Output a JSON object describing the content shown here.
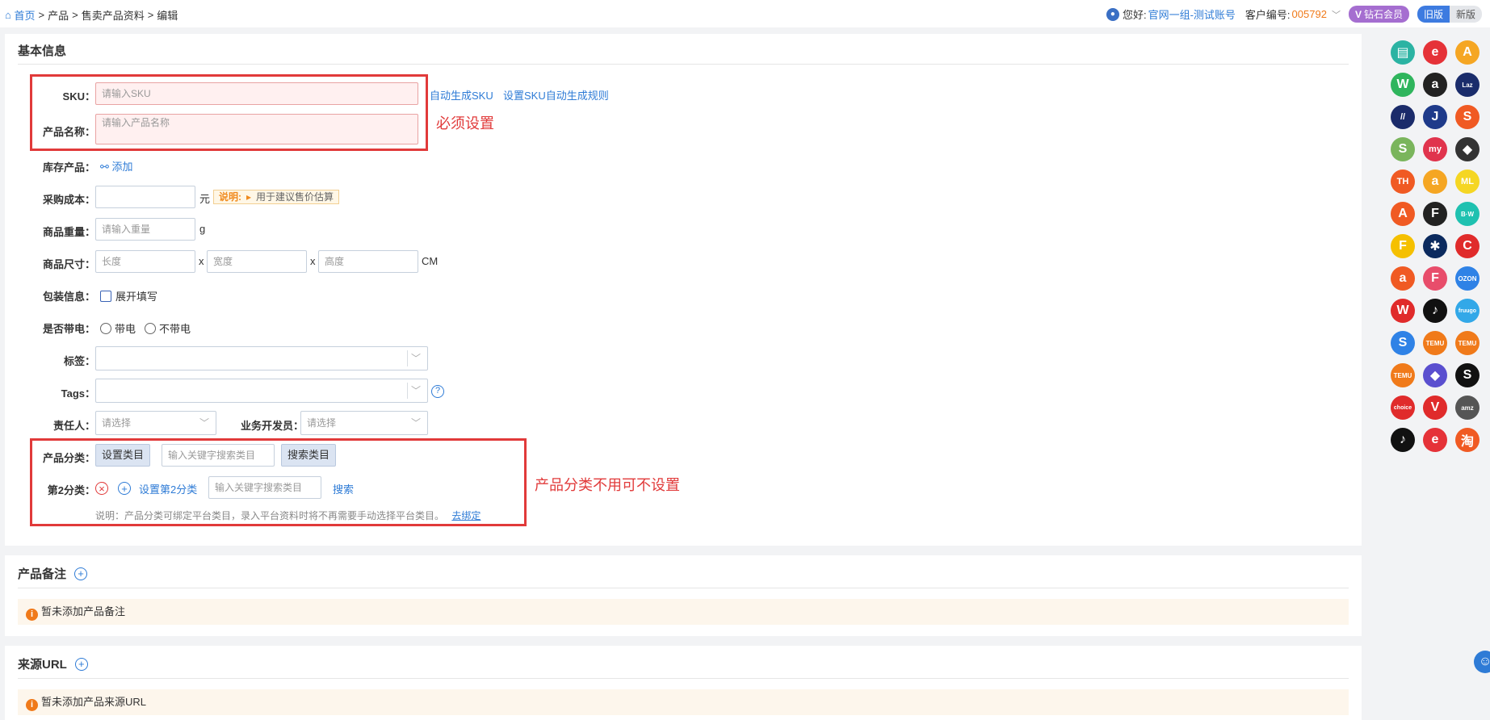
{
  "breadcrumb": {
    "home": "首页",
    "sep": ">",
    "items": [
      "产品",
      "售卖产品资料",
      "编辑"
    ]
  },
  "header": {
    "greeting": "您好:",
    "account": "官网一组-测试账号",
    "customer_label": "客户编号:",
    "customer_no": "005792",
    "vip": "钻石会员",
    "old_version": "旧版",
    "new_version": "新版"
  },
  "basic": {
    "title": "基本信息",
    "sku_label": "SKU：",
    "sku_placeholder": "请输入SKU",
    "auto_sku": "自动生成SKU",
    "sku_rule": "设置SKU自动生成规则",
    "name_label": "产品名称：",
    "name_placeholder": "请输入产品名称",
    "required_note": "必须设置",
    "stock_label": "库存产品：",
    "stock_add": "添加",
    "cost_label": "采购成本：",
    "cost_unit": "元",
    "tip_key": "说明:",
    "tip_text": "用于建议售价估算",
    "weight_label": "商品重量：",
    "weight_placeholder": "请输入重量",
    "weight_unit": "g",
    "size_label": "商品尺寸：",
    "len_placeholder": "长度",
    "wid_placeholder": "宽度",
    "hei_placeholder": "高度",
    "size_x": "x",
    "size_unit": "CM",
    "pack_label": "包装信息：",
    "pack_text": "展开填写",
    "elec_label": "是否带电：",
    "elec_yes": "带电",
    "elec_no": "不带电",
    "tag_label": "标签：",
    "tags_label": "Tags：",
    "owner_label": "责任人：",
    "owner_placeholder": "请选择",
    "dev_label": "业务开发员：",
    "dev_placeholder": "请选择",
    "cat_label": "产品分类：",
    "set_cat": "设置类目",
    "cat_search_placeholder": "输入关键字搜索类目",
    "search_cat": "搜索类目",
    "cat2_label": "第2分类：",
    "set_cat2": "设置第2分类",
    "cat2_search_placeholder": "输入关键字搜索类目",
    "search": "搜索",
    "cat_note": "说明：产品分类可绑定平台类目，录入平台资料时将不再需要手动选择平台类目。",
    "bind_link": "去绑定",
    "cat_red_note": "产品分类不用可不设置"
  },
  "remark": {
    "title": "产品备注",
    "empty": "暂未添加产品备注"
  },
  "source": {
    "title": "来源URL",
    "empty": "暂未添加产品来源URL"
  },
  "platforms": [
    {
      "name": "doc-platform-icon",
      "t": "▤",
      "c": "#2bb3a3"
    },
    {
      "name": "ebay-icon",
      "t": "e",
      "c": "#e53238"
    },
    {
      "name": "aliexpress-a-icon",
      "t": "A",
      "c": "#f5a623"
    },
    {
      "name": "wish-icon",
      "t": "W",
      "c": "#2fb55d"
    },
    {
      "name": "amazon-icon",
      "t": "a",
      "c": "#222"
    },
    {
      "name": "lazada-icon",
      "t": "Laz",
      "c": "#1a2c6b"
    },
    {
      "name": "jumia-icon",
      "t": "//",
      "c": "#1b2b6a"
    },
    {
      "name": "jollychic-icon",
      "t": "J",
      "c": "#1e3a8a"
    },
    {
      "name": "shopee-icon",
      "t": "S",
      "c": "#f05a23"
    },
    {
      "name": "shopify-icon",
      "t": "S",
      "c": "#7ab55c"
    },
    {
      "name": "mymall-icon",
      "t": "my",
      "c": "#e0344d"
    },
    {
      "name": "tag-platform-icon",
      "t": "◆",
      "c": "#333"
    },
    {
      "name": "thisshop-icon",
      "t": "TH",
      "c": "#f05a23"
    },
    {
      "name": "amazon-orange-icon",
      "t": "a",
      "c": "#f5a623"
    },
    {
      "name": "mercadolibre-icon",
      "t": "ML",
      "c": "#f5d623"
    },
    {
      "name": "alibaba-icon",
      "t": "A",
      "c": "#f05a23"
    },
    {
      "name": "fruugo-frame-icon",
      "t": "F",
      "c": "#222"
    },
    {
      "name": "bw-icon",
      "t": "B·W",
      "c": "#1fc1b0"
    },
    {
      "name": "fnac-icon",
      "t": "F",
      "c": "#f5c000"
    },
    {
      "name": "walmart-icon",
      "t": "✱",
      "c": "#0b2a5e"
    },
    {
      "name": "cdiscount-icon",
      "t": "C",
      "c": "#e02b2b"
    },
    {
      "name": "allegro-icon",
      "t": "a",
      "c": "#f05a23"
    },
    {
      "name": "flipkart-f-icon",
      "t": "F",
      "c": "#e84d6b"
    },
    {
      "name": "ozon-icon",
      "t": "OZON",
      "c": "#2f82e6"
    },
    {
      "name": "wayfair-icon",
      "t": "W",
      "c": "#e02b2b"
    },
    {
      "name": "tiktok-icon",
      "t": "♪",
      "c": "#111"
    },
    {
      "name": "fruugo-icon",
      "t": "fruugo",
      "c": "#32a8e8"
    },
    {
      "name": "shein-s-icon",
      "t": "S",
      "c": "#2f82e6"
    },
    {
      "name": "temu-icon",
      "t": "TEMU",
      "c": "#f07a1a"
    },
    {
      "name": "temu-semi-icon",
      "t": "TEMU",
      "c": "#f07a1a"
    },
    {
      "name": "temu-us-icon",
      "t": "TEMU",
      "c": "#f07a1a"
    },
    {
      "name": "diamond-platform-icon",
      "t": "◆",
      "c": "#5a4fcf"
    },
    {
      "name": "shein-icon",
      "t": "S",
      "c": "#111"
    },
    {
      "name": "aliexpress-choice-icon",
      "t": "choice",
      "c": "#e02b2b"
    },
    {
      "name": "v-platform-icon",
      "t": "V",
      "c": "#e02b2b"
    },
    {
      "name": "amazon-cn-icon",
      "t": "amz",
      "c": "#555"
    },
    {
      "name": "tiktok-global-icon",
      "t": "♪",
      "c": "#111"
    },
    {
      "name": "ebay-e-icon",
      "t": "e",
      "c": "#e53238"
    },
    {
      "name": "taobao-icon",
      "t": "淘",
      "c": "#f05a23"
    }
  ]
}
